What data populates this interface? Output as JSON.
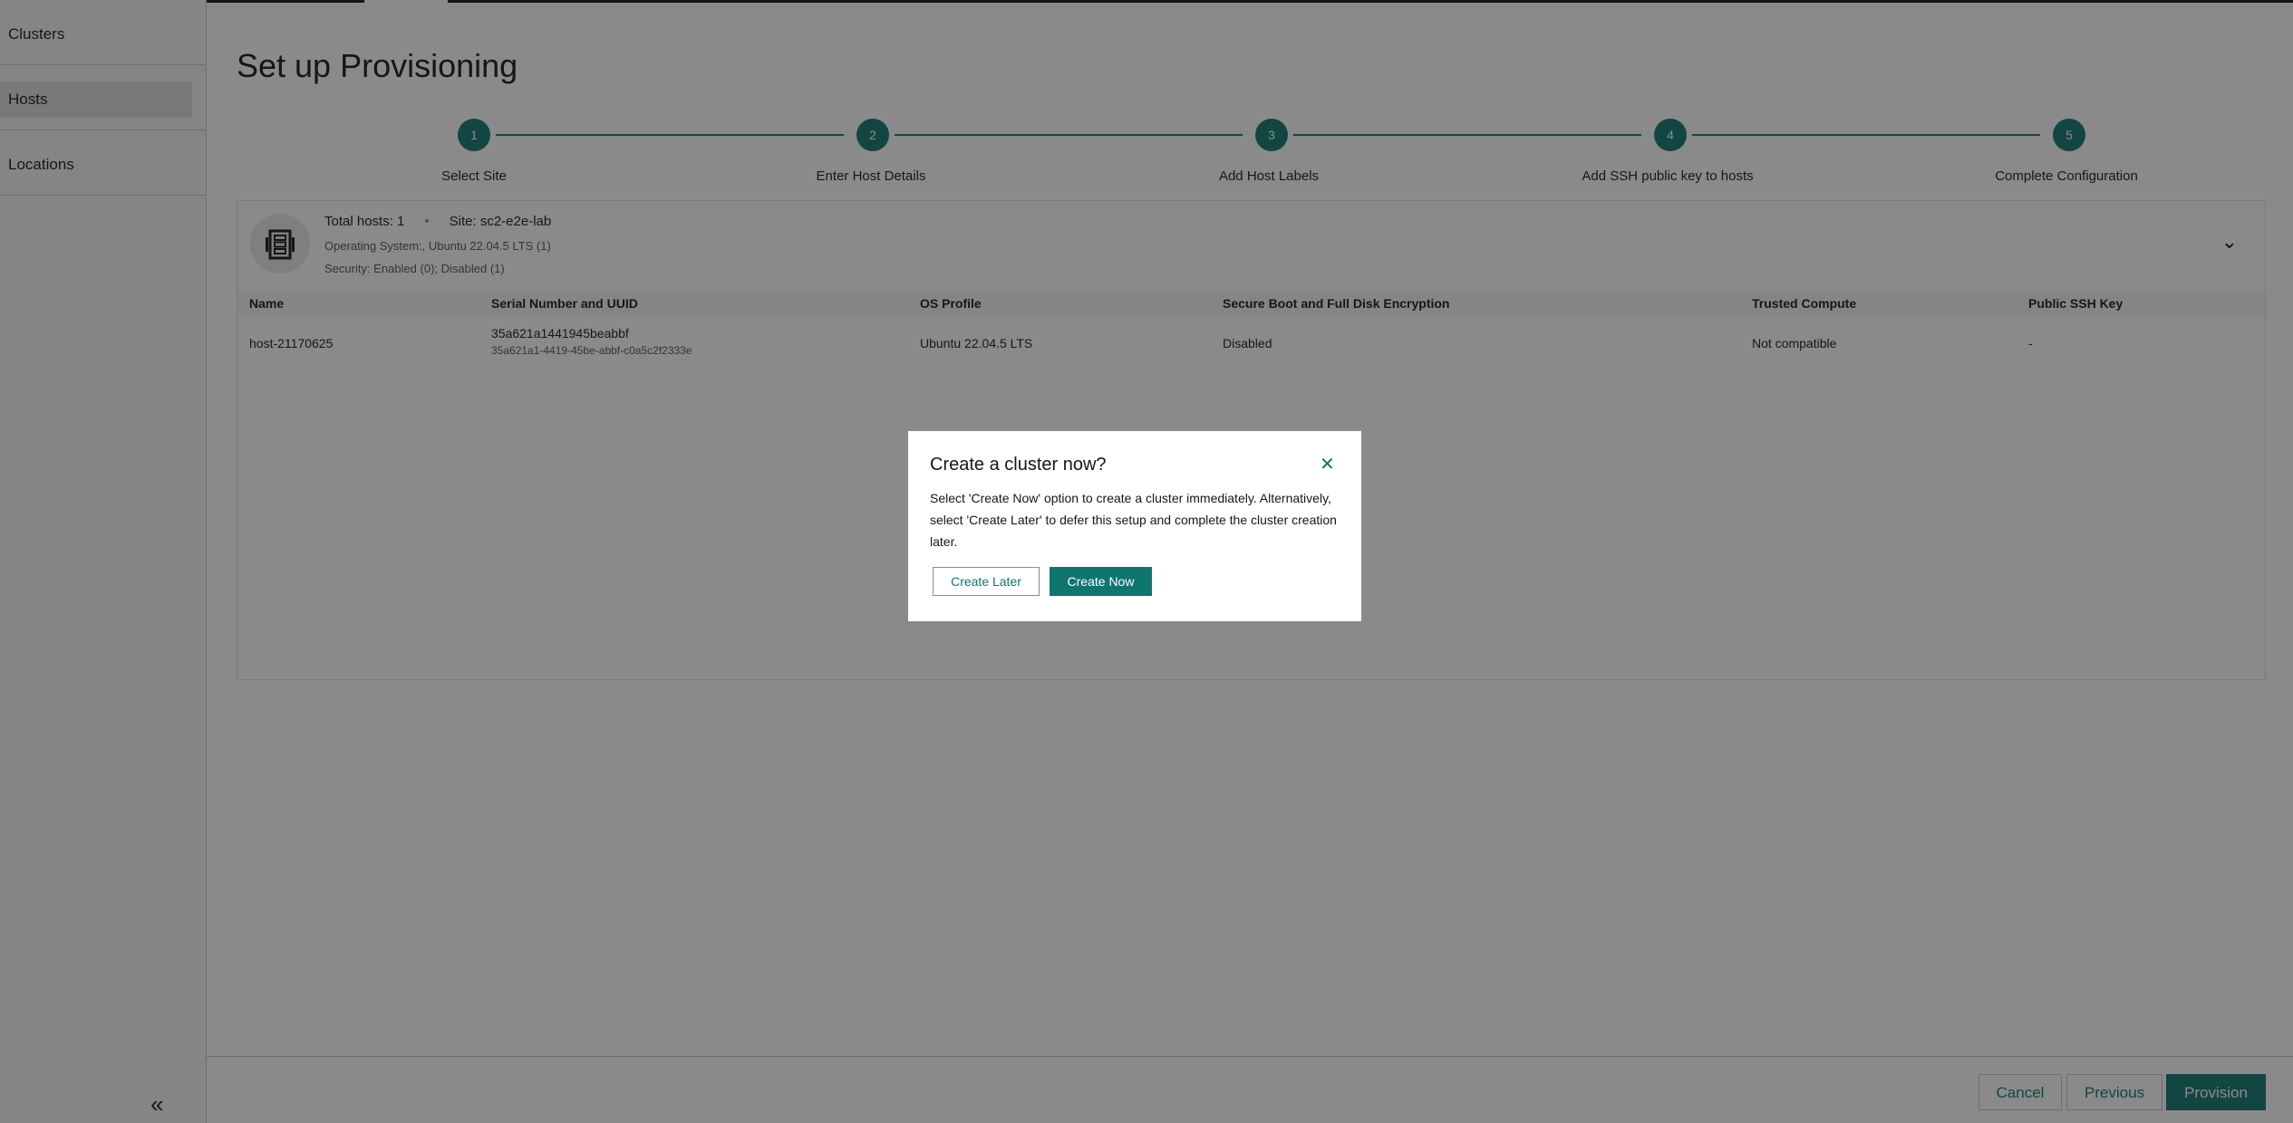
{
  "sidebar": {
    "items": [
      {
        "label": "Clusters"
      },
      {
        "label": "Hosts"
      },
      {
        "label": "Locations"
      }
    ],
    "collapse_icon": "double-chevron-left-icon"
  },
  "page": {
    "title": "Set up Provisioning"
  },
  "stepper": {
    "steps": [
      {
        "number": "1",
        "label": "Select Site"
      },
      {
        "number": "2",
        "label": "Enter Host Details"
      },
      {
        "number": "3",
        "label": "Add Host Labels"
      },
      {
        "number": "4",
        "label": "Add SSH public key to hosts"
      },
      {
        "number": "5",
        "label": "Complete Configuration"
      }
    ]
  },
  "summary": {
    "total_hosts": "Total hosts: 1",
    "site": "Site: sc2-e2e-lab",
    "os": "Operating System:,  Ubuntu 22.04.5 LTS (1)",
    "security": "Security: Enabled (0);  Disabled (1)"
  },
  "table": {
    "headers": [
      "Name",
      "Serial Number and UUID",
      "OS Profile",
      "Secure Boot and Full Disk Encryption",
      "Trusted Compute",
      "Public SSH Key"
    ],
    "rows": [
      {
        "name": "host-21170625",
        "serial": "35a621a1441945beabbf",
        "uuid": "35a621a1-4419-45be-abbf-c0a5c2f2333e",
        "os_profile": "Ubuntu 22.04.5 LTS",
        "secure_boot": "Disabled",
        "trusted_compute": "Not compatible",
        "ssh_key": "-"
      }
    ]
  },
  "footer": {
    "cancel": "Cancel",
    "previous": "Previous",
    "provision": "Provision"
  },
  "modal": {
    "title": "Create a cluster now?",
    "body": "Select 'Create Now' option to create a cluster immediately. Alternatively, select 'Create Later' to defer this setup and complete the cluster creation later.",
    "create_later": "Create Later",
    "create_now": "Create Now",
    "close_icon": "close-icon"
  },
  "colors": {
    "accent": "#0f766e",
    "overlay": "rgba(22,22,22,0.5)"
  }
}
